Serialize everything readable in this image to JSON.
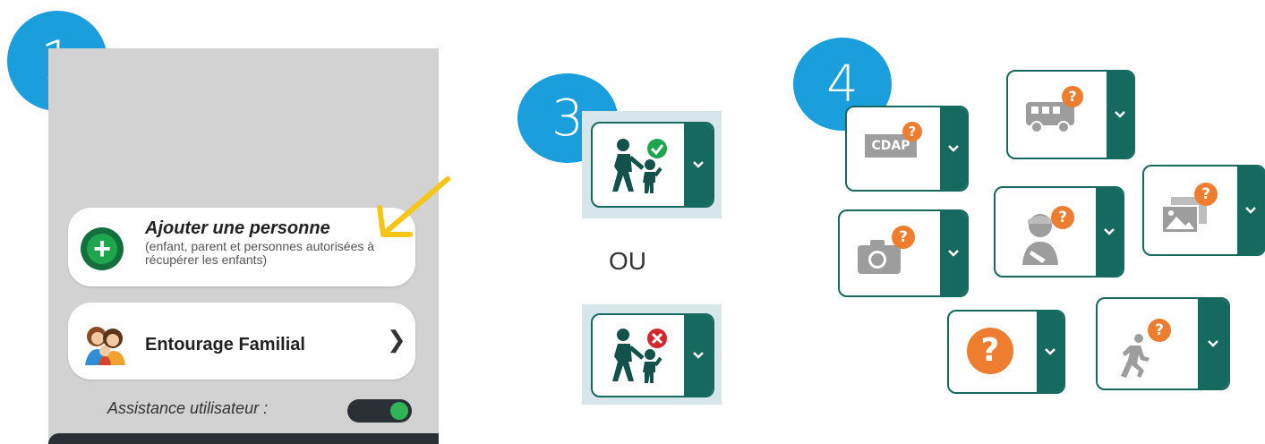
{
  "steps": {
    "one": "1",
    "three": "3",
    "four": "4"
  },
  "panel": {
    "add_person_title": "Ajouter une personne",
    "add_person_desc": "(enfant, parent et personnes autorisées à récupérer les enfants)",
    "family_title": "Entourage Familial",
    "assist_label": "Assistance utilisateur :",
    "assist_on": true
  },
  "state_buttons": {
    "separator": "OU"
  },
  "options": {
    "cdap_label": "CDAP",
    "question_mark": "?"
  },
  "colors": {
    "step_blue": "#1a9fdc",
    "teal": "#15695f",
    "green": "#1ea64f",
    "orange": "#ef7d2f",
    "red": "#d6262e",
    "panel_grey": "#d2d2d2"
  }
}
